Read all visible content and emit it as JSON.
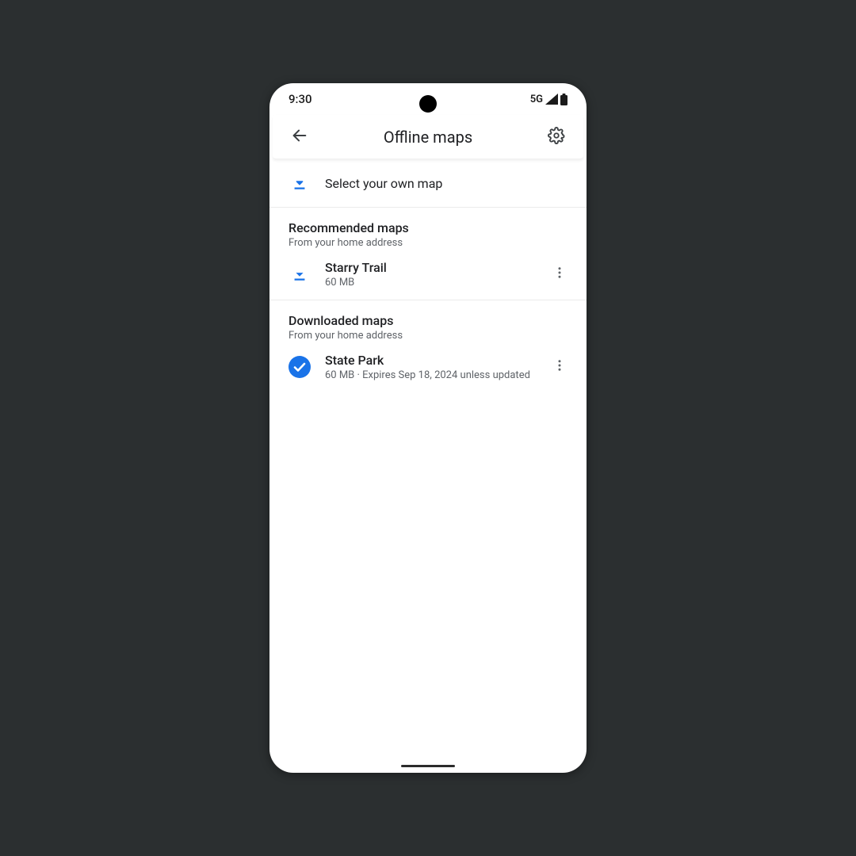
{
  "statusbar": {
    "time": "9:30",
    "network": "5G"
  },
  "appbar": {
    "title": "Offline maps"
  },
  "select_row": {
    "label": "Select your own map"
  },
  "recommended": {
    "title": "Recommended maps",
    "subtitle": "From your home address",
    "items": [
      {
        "name": "Starry Trail",
        "sub": "60 MB"
      }
    ]
  },
  "downloaded": {
    "title": "Downloaded maps",
    "subtitle": "From your home address",
    "items": [
      {
        "name": "State Park",
        "sub": "60  MB · Expires Sep 18, 2024 unless updated"
      }
    ]
  },
  "colors": {
    "accent": "#1a73e8"
  }
}
